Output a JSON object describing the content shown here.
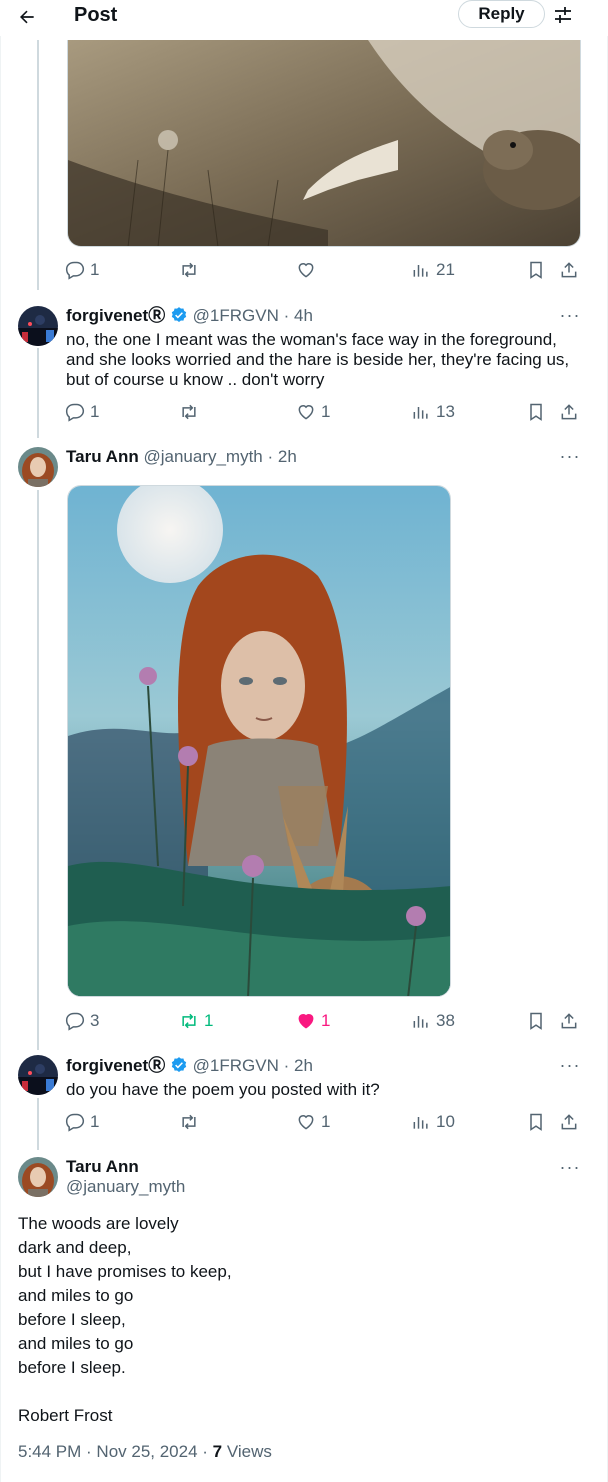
{
  "header": {
    "title": "Post",
    "reply_label": "Reply"
  },
  "icons": {
    "back": "arrow-left-icon",
    "settings": "sliders-icon"
  },
  "colors": {
    "text": "#0f1419",
    "muted": "#536471",
    "verified": "#1d9bf0",
    "retweet_active": "#00ba7c",
    "like_active": "#f91880",
    "border": "#cfd9de"
  },
  "thread": [
    {
      "id": "t0",
      "actions": {
        "replies": "1",
        "reposts": "",
        "likes": "",
        "views": "21"
      }
    },
    {
      "id": "t1",
      "author": {
        "name": "forgivenet",
        "suffix": "Ⓡ",
        "handle": "@1FRGVN",
        "time": "· 4h"
      },
      "text": "no, the one I meant was the woman's face way in the foreground, and she looks worried and the hare is beside her, they're facing us, but of course u know .. don't worry",
      "actions": {
        "replies": "1",
        "reposts": "",
        "likes": "1",
        "views": "13"
      }
    },
    {
      "id": "t2",
      "author": {
        "name": "Taru Ann",
        "handle": "@january_myth",
        "time": "· 2h"
      },
      "actions": {
        "replies": "3",
        "reposts": "1",
        "likes": "1",
        "views": "38"
      }
    },
    {
      "id": "t3",
      "author": {
        "name": "forgivenet",
        "suffix": "Ⓡ",
        "handle": "@1FRGVN",
        "time": "· 2h"
      },
      "text": "do you have the poem you posted with it?",
      "actions": {
        "replies": "1",
        "reposts": "",
        "likes": "1",
        "views": "10"
      }
    }
  ],
  "main": {
    "author": {
      "name": "Taru Ann",
      "handle": "@january_myth"
    },
    "lines": [
      "The woods are lovely",
      "dark and deep,",
      "but I have promises to keep,",
      "and miles to go",
      "before I sleep,",
      "and miles to go",
      "before I sleep.",
      "",
      "Robert Frost"
    ],
    "time": "5:44 PM",
    "date": "Nov 25, 2024",
    "views_count": "7",
    "views_label": "Views"
  }
}
